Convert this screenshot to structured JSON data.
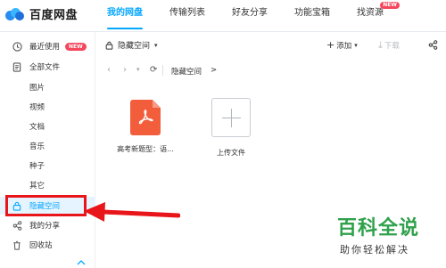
{
  "app": {
    "logo_text": "百度网盘"
  },
  "nav": {
    "tabs": [
      {
        "label": "我的网盘",
        "active": true
      },
      {
        "label": "传输列表"
      },
      {
        "label": "好友分享"
      },
      {
        "label": "功能宝箱"
      },
      {
        "label": "找资源",
        "badge": "NEW"
      }
    ]
  },
  "sidebar": {
    "items": [
      {
        "label": "最近使用",
        "icon": "clock-icon",
        "badge": "NEW"
      },
      {
        "label": "全部文件",
        "icon": "document-icon"
      },
      {
        "label": "图片"
      },
      {
        "label": "视频"
      },
      {
        "label": "文档"
      },
      {
        "label": "音乐"
      },
      {
        "label": "种子"
      },
      {
        "label": "其它"
      },
      {
        "label": "隐藏空间",
        "icon": "lock-icon",
        "selected": true
      },
      {
        "label": "我的分享",
        "icon": "share-icon"
      },
      {
        "label": "回收站",
        "icon": "trash-icon"
      }
    ]
  },
  "toolbar": {
    "folder_selector": "隐藏空间",
    "add_label": "添加",
    "download_label": "下载"
  },
  "pathbar": {
    "crumb": "隐藏空间",
    "crumb_sep": ">"
  },
  "files": [
    {
      "name": "高考新题型：语...",
      "icon": "pdf-file-icon"
    },
    {
      "name": "上传文件",
      "icon": "upload-plus-icon"
    }
  ],
  "watermark": {
    "title": "百科全说",
    "subtitle": "助你轻松解决"
  },
  "colors": {
    "accent": "#06a7ff",
    "badge": "#f5475c",
    "highlight": "#e8161a",
    "pdf": "#f25d3c",
    "watermark": "#2fa14b"
  }
}
